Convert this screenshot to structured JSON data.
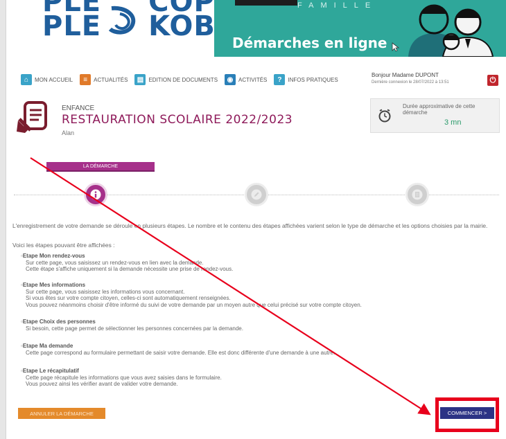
{
  "banner": {
    "logo_line1": "PLE",
    "logo_line1b": "COP",
    "logo_line2": "PLE",
    "logo_line2b": "KOB",
    "famille": "FAMILLE",
    "subtitle": "Démarches en ligne"
  },
  "nav": {
    "items": [
      {
        "label": "MON ACCUEIL",
        "icon": "home-icon",
        "color": "#3aa3c8"
      },
      {
        "label": "ACTUALITÉS",
        "icon": "news-icon",
        "color": "#e07a2a"
      },
      {
        "label": "EDITION DE DOCUMENTS",
        "icon": "document-icon",
        "color": "#3aa3c8"
      },
      {
        "label": "ACTIVITÉS",
        "icon": "activities-icon",
        "color": "#2a7fb8"
      },
      {
        "label": "INFOS PRATIQUES",
        "icon": "info-icon",
        "color": "#3aa3c8"
      }
    ]
  },
  "user": {
    "greeting": "Bonjour Madame DUPONT",
    "last_login": "Dernière connexion le 28/07/2022 à 13:51"
  },
  "page": {
    "category": "ENFANCE",
    "title": "RESTAURATION SCOLAIRE 2022/2023",
    "child": "Alan"
  },
  "duration": {
    "label": "Durée approximative de cette démarche",
    "value": "3 mn"
  },
  "tab": {
    "label": "LA DÉMARCHE"
  },
  "content": {
    "intro": "L'enregistrement de votre demande se déroule en plusieurs étapes. Le nombre et le contenu des étapes affichées varient selon le type de démarche et les options choisies par la mairie.",
    "intro2": "Voici les étapes pouvant être affichées :",
    "steps": [
      {
        "title": "Etape Mon rendez-vous",
        "lines": [
          "Sur cette page, vous saisissez un rendez-vous en lien avec la demande.",
          "Cette étape s'affiche uniquement si la demande nécessite une prise de rendez-vous."
        ]
      },
      {
        "title": "Etape Mes informations",
        "lines": [
          "Sur cette page, vous saisissez les informations vous concernant.",
          "Si vous êtes sur votre compte citoyen, celles-ci sont automatiquement renseignées.",
          "Vous pouvez néanmoins choisir d'être informé du suivi de votre demande par un moyen autre que celui précisé sur votre compte citoyen."
        ]
      },
      {
        "title": "Etape Choix des personnes",
        "lines": [
          "Si besoin, cette page permet de sélectionner les personnes concernées par la demande."
        ]
      },
      {
        "title": "Etape Ma demande",
        "lines": [
          "Cette page correspond au formulaire permettant de saisir votre demande. Elle est donc différente d'une demande à une autre."
        ]
      },
      {
        "title": "Etape Le récapitulatif",
        "lines": [
          "Cette page récapitule les informations que vous avez saisies dans le formulaire.",
          "Vous pouvez ainsi les vérifier avant de valider votre demande."
        ]
      }
    ]
  },
  "buttons": {
    "cancel": "ANNULER LA DÉMARCHE",
    "start": "COMMENCER >"
  },
  "colors": {
    "accent": "#a6308a",
    "teal": "#2fa79a",
    "start_button": "#2c3385",
    "cancel_button": "#e48a2b",
    "highlight": "#e8001c"
  }
}
